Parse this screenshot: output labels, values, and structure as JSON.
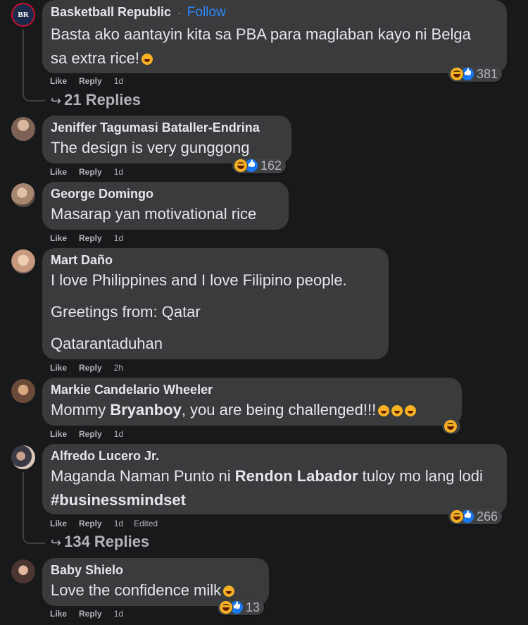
{
  "actions": {
    "like": "Like",
    "reply": "Reply",
    "edited": "Edited"
  },
  "comments": [
    {
      "author": "Basketball Republic",
      "follow": "Follow",
      "dot": "·",
      "text": "Basta ako aantayin kita sa PBA para maglaban kayo ni Belga sa extra rice!",
      "time": "1d",
      "reactions": "381",
      "replies": "21 Replies"
    },
    {
      "author": "Jeniffer Tagumasi Bataller-Endrina",
      "text": "The design is very gunggong",
      "time": "1d",
      "reactions": "162"
    },
    {
      "author": "George Domingo",
      "text": "Masarap yan motivational rice",
      "time": "1d"
    },
    {
      "author": "Mart Daño",
      "paragraphs": [
        "I love Philippines and I love Filipino people.",
        "Greetings from: Qatar",
        "Qatarantaduhan"
      ],
      "time": "2h"
    },
    {
      "author": "Markie Candelario Wheeler",
      "text_before": "Mommy ",
      "text_bold": "Bryanboy",
      "text_after": ", you are being challenged!!!",
      "time": "1d"
    },
    {
      "author": "Alfredo Lucero Jr.",
      "text_before": "Maganda Naman Punto ni ",
      "text_bold": "Rendon Labador",
      "text_after": " tuloy mo lang lodi ",
      "text_bold2": "#businessmindset",
      "time": "1d",
      "reactions": "266",
      "replies": "134 Replies"
    },
    {
      "author": "Baby Shielo",
      "text": "Love the confidence milk",
      "time": "1d",
      "reactions": "13"
    }
  ]
}
